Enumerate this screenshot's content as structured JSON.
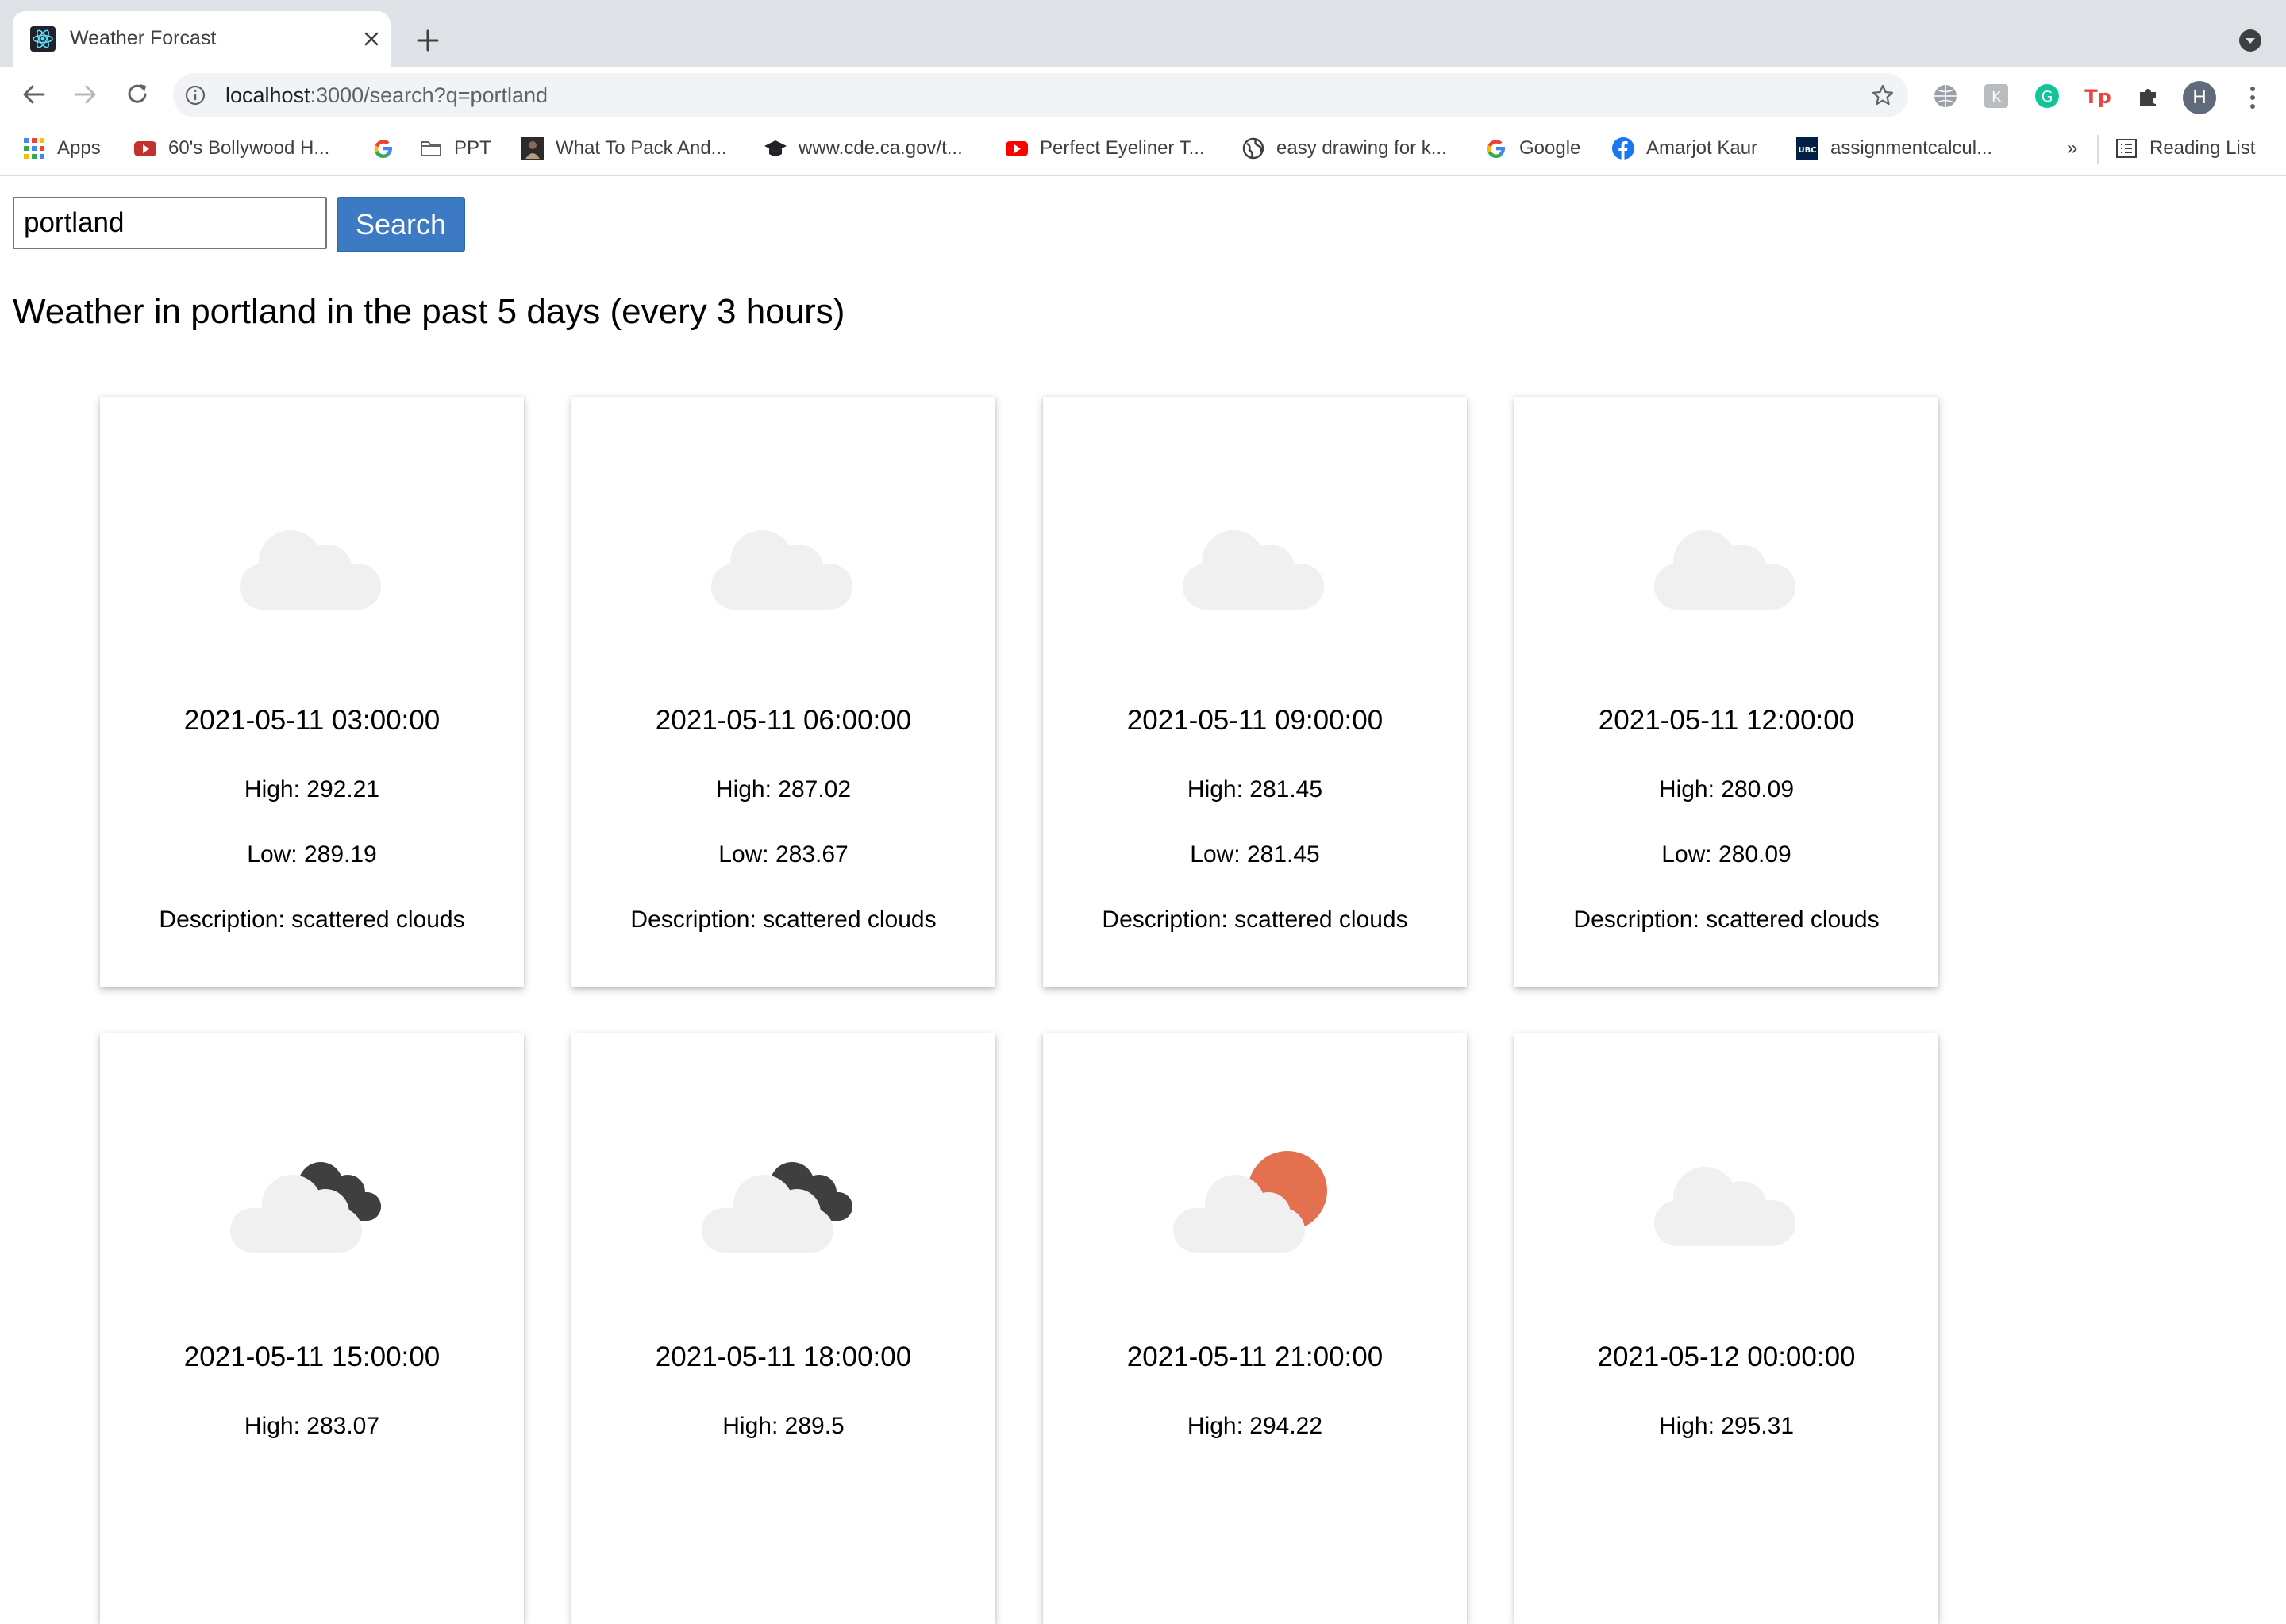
{
  "browser": {
    "tab_title": "Weather Forcast",
    "url_host": "localhost",
    "url_rest": ":3000/search?q=portland",
    "profile_initial": "H",
    "bookmarks": [
      {
        "label": "Apps",
        "icon": "apps-grid-icon"
      },
      {
        "label": "60's Bollywood H...",
        "icon": "youtube-icon"
      },
      {
        "label": "",
        "icon": "google-icon"
      },
      {
        "label": "PPT",
        "icon": "folder-icon"
      },
      {
        "label": "What To Pack And...",
        "icon": "site-icon"
      },
      {
        "label": "www.cde.ca.gov/t...",
        "icon": "graduation-cap-icon"
      },
      {
        "label": "Perfect Eyeliner T...",
        "icon": "youtube-icon"
      },
      {
        "label": "easy drawing for k...",
        "icon": "globe-icon"
      },
      {
        "label": "Google",
        "icon": "google-icon"
      },
      {
        "label": "Amarjot Kaur",
        "icon": "facebook-icon"
      },
      {
        "label": "assignmentcalcul...",
        "icon": "ubc-icon"
      }
    ],
    "overflow_label": "»",
    "reading_list_label": "Reading List"
  },
  "search": {
    "value": "portland",
    "button_label": "Search"
  },
  "heading": "Weather in portland in the past 5 days (every 3 hours)",
  "forecasts": [
    {
      "time": "2021-05-11 03:00:00",
      "high": "High: 292.21",
      "low": "Low: 289.19",
      "description": "Description: scattered clouds",
      "icon": "cloud-icon"
    },
    {
      "time": "2021-05-11 06:00:00",
      "high": "High: 287.02",
      "low": "Low: 283.67",
      "description": "Description: scattered clouds",
      "icon": "cloud-icon"
    },
    {
      "time": "2021-05-11 09:00:00",
      "high": "High: 281.45",
      "low": "Low: 281.45",
      "description": "Description: scattered clouds",
      "icon": "cloud-icon"
    },
    {
      "time": "2021-05-11 12:00:00",
      "high": "High: 280.09",
      "low": "Low: 280.09",
      "description": "Description: scattered clouds",
      "icon": "cloud-icon"
    },
    {
      "time": "2021-05-11 15:00:00",
      "high": "High: 283.07",
      "icon": "broken-clouds-icon"
    },
    {
      "time": "2021-05-11 18:00:00",
      "high": "High: 289.5",
      "icon": "broken-clouds-icon"
    },
    {
      "time": "2021-05-11 21:00:00",
      "high": "High: 294.22",
      "icon": "cloud-sun-icon"
    },
    {
      "time": "2021-05-12 00:00:00",
      "high": "High: 295.31",
      "icon": "cloud-icon"
    }
  ],
  "colors": {
    "search_button": "#3d7ac4",
    "cloud_light": "#f0f0f0",
    "cloud_dark": "#3f3f3f",
    "sun": "#e3704e"
  }
}
